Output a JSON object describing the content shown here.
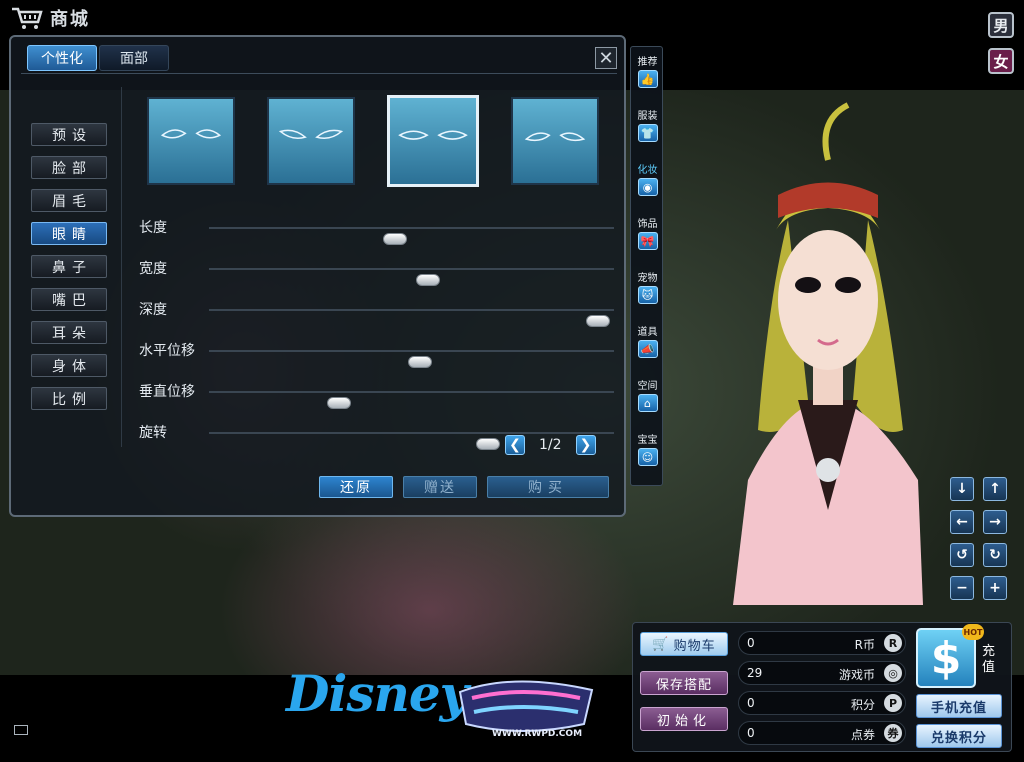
{
  "header": {
    "title": "商城"
  },
  "gender": {
    "male": "男",
    "female": "女"
  },
  "tabs": [
    {
      "label": "个性化",
      "active": true
    },
    {
      "label": "面部",
      "active": false
    }
  ],
  "close_label": "✕",
  "categories": [
    {
      "label": "预设",
      "active": false
    },
    {
      "label": "脸部",
      "active": false
    },
    {
      "label": "眉毛",
      "active": false
    },
    {
      "label": "眼睛",
      "active": true
    },
    {
      "label": "鼻子",
      "active": false
    },
    {
      "label": "嘴巴",
      "active": false
    },
    {
      "label": "耳朵",
      "active": false
    },
    {
      "label": "身体",
      "active": false
    },
    {
      "label": "比例",
      "active": false
    }
  ],
  "eye_presets": {
    "count": 4,
    "selected_index": 2
  },
  "sliders": [
    {
      "label": "长度",
      "value": 0.46
    },
    {
      "label": "宽度",
      "value": 0.54
    },
    {
      "label": "深度",
      "value": 0.96
    },
    {
      "label": "水平位移",
      "value": 0.52
    },
    {
      "label": "垂直位移",
      "value": 0.32
    },
    {
      "label": "旋转",
      "value": 0.69
    }
  ],
  "pager": {
    "text": "1/2",
    "prev": "❮",
    "next": "❯"
  },
  "actions": {
    "restore": "还原",
    "gift": "赠送",
    "buy": "购买"
  },
  "side_menu": [
    {
      "label": "推荐",
      "icon": "thumbs-up-icon",
      "glyph": "👍",
      "active": false
    },
    {
      "label": "服装",
      "icon": "shirt-icon",
      "glyph": "👕",
      "active": false
    },
    {
      "label": "化妆",
      "icon": "makeup-icon",
      "glyph": "◉",
      "active": true
    },
    {
      "label": "饰品",
      "icon": "bow-icon",
      "glyph": "🎀",
      "active": false
    },
    {
      "label": "宠物",
      "icon": "pet-icon",
      "glyph": "🐱",
      "active": false
    },
    {
      "label": "道具",
      "icon": "megaphone-icon",
      "glyph": "📣",
      "active": false
    },
    {
      "label": "空间",
      "icon": "house-icon",
      "glyph": "⌂",
      "active": false
    },
    {
      "label": "宝宝",
      "icon": "baby-icon",
      "glyph": "☺",
      "active": false
    }
  ],
  "camera": {
    "down": "↓",
    "up": "↑",
    "left": "←",
    "right": "→",
    "rotate_left": "↺",
    "rotate_right": "↻",
    "zoom_out": "−",
    "zoom_in": "+"
  },
  "shop": {
    "cart": "购物车",
    "save_outfit": "保存搭配",
    "init": "初始化",
    "currencies": [
      {
        "value": "0",
        "label": "R币",
        "icon": "r-coin-icon",
        "glyph": "R"
      },
      {
        "value": "29",
        "label": "游戏币",
        "icon": "game-coin-icon",
        "glyph": "◎"
      },
      {
        "value": "0",
        "label": "积分",
        "icon": "points-icon",
        "glyph": "P"
      },
      {
        "value": "0",
        "label": "点券",
        "icon": "coupon-icon",
        "glyph": "券"
      }
    ],
    "recharge_symbol": "$",
    "hot_badge": "HOT",
    "recharge_label": "充值",
    "mobile_recharge": "手机充值",
    "redeem_points": "兑换积分"
  },
  "logos": {
    "disney": "Disney",
    "game_url": "WWW.RWPD.COM"
  },
  "colors": {
    "accent": "#2d84cf",
    "highlight": "#5fd0ff"
  }
}
